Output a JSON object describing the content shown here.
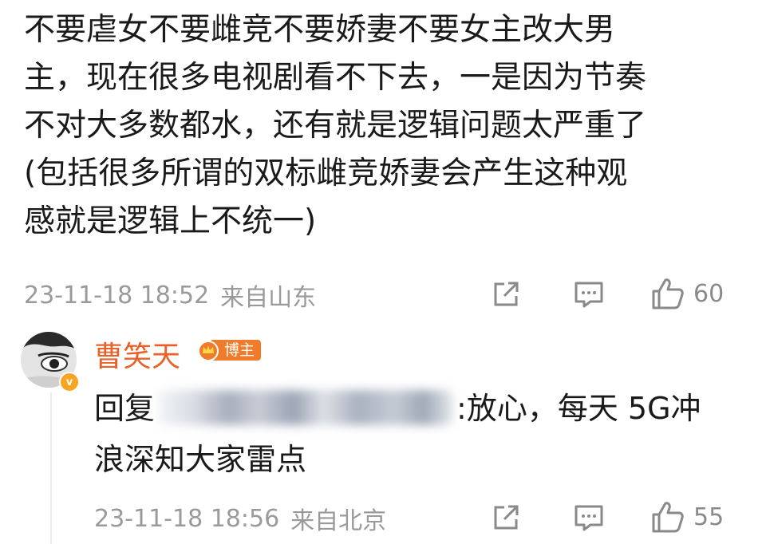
{
  "post": {
    "lines": [
      "不要虐女不要雌竞不要娇妻不要女主改大男",
      "主，现在很多电视剧看不下去，一是因为节奏",
      "不对大多数都水，还有就是逻辑问题太严重了",
      "(包括很多所谓的双标雌竞娇妻会产生这种观",
      "感就是逻辑上不统一)"
    ],
    "timestamp": "23-11-18 18:52",
    "location": "来自山东",
    "like_count": "60"
  },
  "reply": {
    "username": "曹笑天",
    "badge_label": "博主",
    "verified_badge": "v",
    "reply_prefix": "回复",
    "reply_line1_after": ":放心，每天 5G冲",
    "reply_line2": "浪深知大家雷点",
    "timestamp": "23-11-18 18:56",
    "location": "来自北京",
    "like_count": "55"
  },
  "icons": {
    "share": "share-icon",
    "comment": "comment-icon",
    "like": "thumbs-up-icon",
    "blogger": "crown-icon"
  },
  "colors": {
    "username": "#e8622a",
    "badge": "#f07b2b",
    "meta": "#9a9a9a",
    "verified": "#f6a623"
  }
}
